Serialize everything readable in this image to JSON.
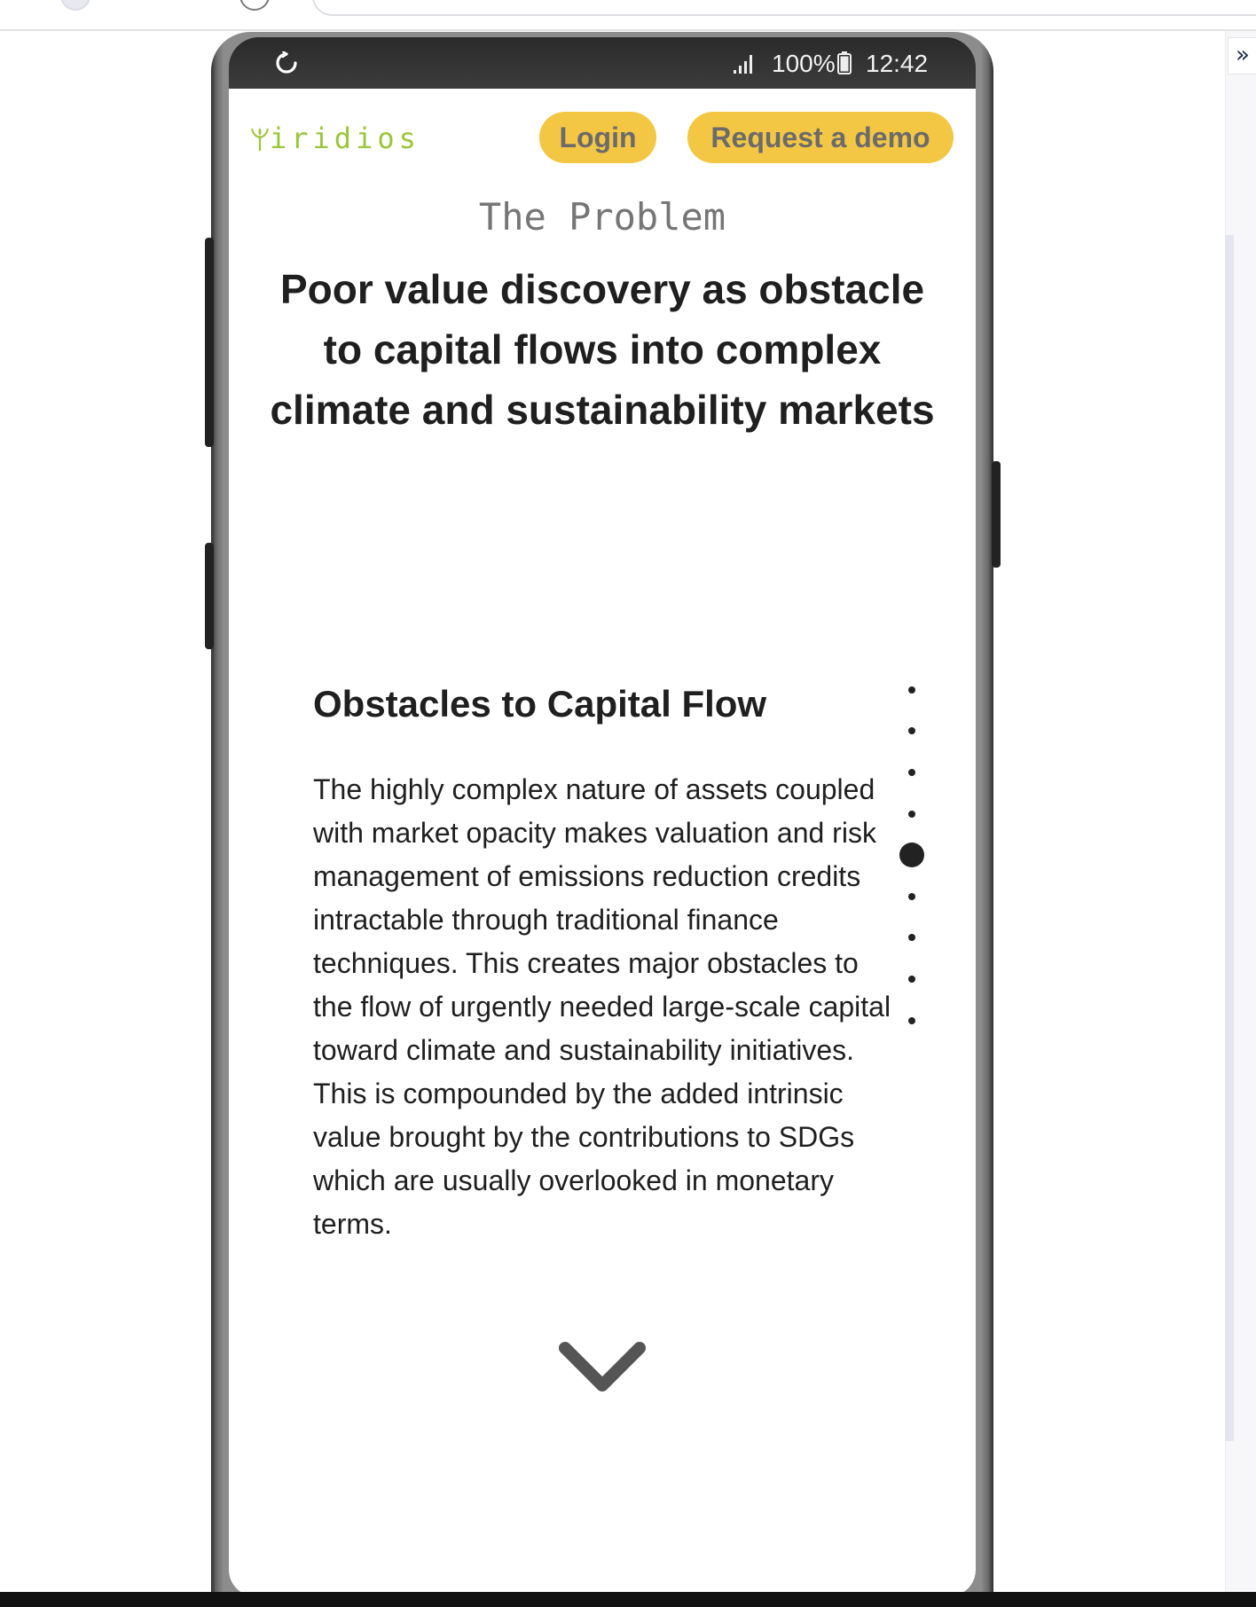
{
  "browser": {
    "expand_glyph": "»"
  },
  "status_bar": {
    "battery_percent": "100%",
    "time": "12:42"
  },
  "header": {
    "logo_text": "iridios",
    "login_label": "Login",
    "demo_label": "Request a demo"
  },
  "hero": {
    "section_label": "The Problem",
    "headline": "Poor value discovery as obstacle to capital flows into complex climate and sustainability markets"
  },
  "card": {
    "title": "Obstacles to Capital Flow",
    "body": "The highly complex nature of assets coupled with market opacity makes valuation and risk management of emissions reduction credits intractable through traditional finance techniques. This creates major obstacles to the flow of urgently needed large-scale capital toward climate and sustainability initiatives. This is compounded by the added intrinsic value brought by the contributions to SDGs which are usually overlooked in monetary terms."
  },
  "pagination": {
    "total": 9,
    "active_index": 4
  },
  "colors": {
    "accent_yellow": "#f3c744",
    "logo_green": "#9bc63a",
    "button_text": "#6b6b6b",
    "heading_text": "#1f1f1f"
  },
  "icons": {
    "reload": "reload-icon",
    "signal": "signal-icon",
    "battery": "battery-icon",
    "scroll_down": "chevron-down-icon",
    "logo_mark": "sprout-icon"
  }
}
